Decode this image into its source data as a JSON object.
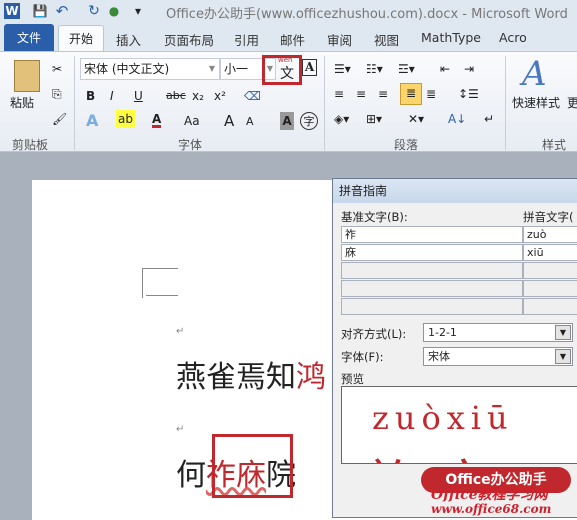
{
  "window": {
    "title": "Office办公助手(www.officezhushou.com).docx  -  Microsoft Word"
  },
  "quick_access": {
    "word": "W",
    "save": "💾",
    "undo": "↶",
    "redo": "↻",
    "dropdown": "▾"
  },
  "tabs": [
    "文件",
    "开始",
    "插入",
    "页面布局",
    "引用",
    "邮件",
    "审阅",
    "视图",
    "MathType",
    "Acro"
  ],
  "ribbon": {
    "clipboard": {
      "label": "剪贴板",
      "paste": "粘贴"
    },
    "font": {
      "label": "字体",
      "font_name": "宋体 (中文正文)",
      "font_size": "小一",
      "phonetic_top": "wén",
      "phonetic_char": "文",
      "bold": "B",
      "italic": "I",
      "underline": "U",
      "strike": "abc",
      "sub": "x₂",
      "sup": "x²",
      "change_case": "Aa",
      "grow": "A",
      "shrink": "A",
      "char_shade": "A",
      "enclose": "字"
    },
    "paragraph": {
      "label": "段落"
    },
    "styles": {
      "label": "样式",
      "quick_styles": "快速样式",
      "more": "更"
    }
  },
  "document": {
    "line1": "燕雀焉知",
    "line1_red": "鸿",
    "line2_a": "何",
    "line2_red": "祚庥",
    "line2_b": "院",
    "para_mark": "↵"
  },
  "dialog": {
    "title": "拼音指南",
    "base_label": "基准文字(B):",
    "ruby_label": "拼音文字(",
    "rows": [
      {
        "base": "祚",
        "ruby": "zuò"
      },
      {
        "base": "庥",
        "ruby": "xiū"
      },
      {
        "base": "",
        "ruby": ""
      },
      {
        "base": "",
        "ruby": ""
      },
      {
        "base": "",
        "ruby": ""
      }
    ],
    "align_label": "对齐方式(L):",
    "align_value": "1-2-1",
    "font_label": "字体(F):",
    "font_value": "宋体",
    "preview_label": "预览",
    "preview_pinyin": "zuòxiū",
    "preview_chars": "祚庥"
  },
  "watermark": {
    "line1": "Office办公助手",
    "line2": "Office教程学习网",
    "line3": "www.office68.com"
  },
  "colors": {
    "accent": "#2a5ea8",
    "highlight": "#c0282d"
  }
}
